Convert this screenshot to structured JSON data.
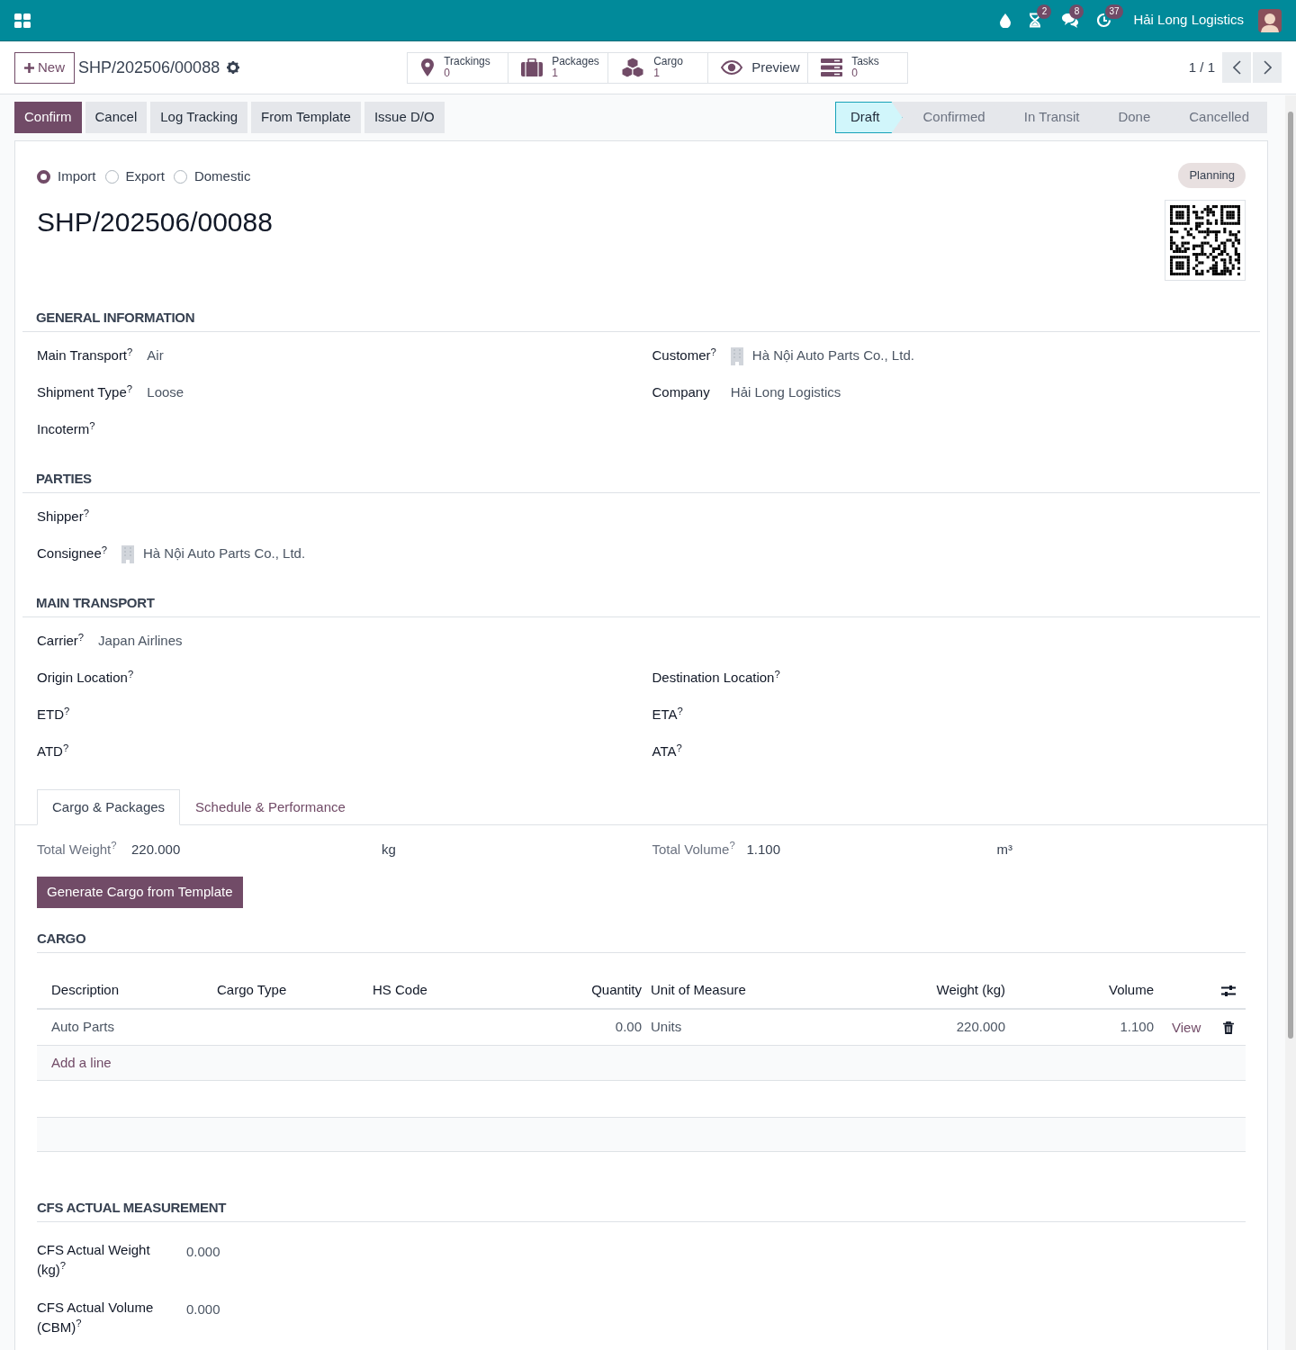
{
  "navbar": {
    "company": "Hải Long Logistics",
    "badges": [
      "2",
      "8",
      "37"
    ]
  },
  "control_panel": {
    "new_button": "New",
    "record_name": "SHP/202506/00088",
    "pager": "1 / 1",
    "smart_buttons": [
      {
        "label": "Trackings",
        "count": "0"
      },
      {
        "label": "Packages",
        "count": "1"
      },
      {
        "label": "Cargo",
        "count": "1"
      },
      {
        "label": "Preview"
      },
      {
        "label": "Tasks",
        "count": "0"
      }
    ]
  },
  "actions": [
    {
      "label": "Confirm",
      "kind": "primary"
    },
    {
      "label": "Cancel",
      "kind": "secondary"
    },
    {
      "label": "Log Tracking",
      "kind": "secondary"
    },
    {
      "label": "From Template",
      "kind": "secondary"
    },
    {
      "label": "Issue D/O",
      "kind": "secondary"
    }
  ],
  "stages": [
    {
      "label": "Draft",
      "selected": true
    },
    {
      "label": "Confirmed",
      "selected": false
    },
    {
      "label": "In Transit",
      "selected": false
    },
    {
      "label": "Done",
      "selected": false
    },
    {
      "label": "Cancelled",
      "selected": false
    }
  ],
  "form": {
    "direction": [
      {
        "label": "Import",
        "selected": true
      },
      {
        "label": "Export",
        "selected": false
      },
      {
        "label": "Domestic",
        "selected": false
      }
    ],
    "tag": "Planning",
    "title": "SHP/202506/00088",
    "sections": [
      {
        "title": "GENERAL INFORMATION",
        "columns": [
          [
            {
              "label": "Main Transport$^{?}$",
              "value": "Air"
            },
            {
              "label": "Shipment Type$^{?}$",
              "value": "Loose"
            },
            {
              "label": "Incoterm$^{?}$"
            }
          ],
          [
            {
              "label": "Customer$^{?}$",
              "value": "Hà Nội Auto Parts Co., Ltd.",
              "kind": "partner"
            },
            {
              "label": "Company",
              "value": "Hải Long Logistics"
            }
          ]
        ]
      },
      {
        "title": "PARTIES",
        "fields": [
          {
            "label": "Shipper$^{?}$"
          },
          {
            "label": "Consignee$^{?}$",
            "value": "Hà Nội Auto Parts Co., Ltd.",
            "kind": "partner"
          }
        ]
      },
      {
        "title": "MAIN TRANSPORT",
        "fields": [
          {
            "label": "Carrier$^{?}$",
            "value": "Japan Airlines"
          }
        ],
        "columns": [
          [
            {
              "label": "Origin Location$^{?}$"
            },
            {
              "label": "ETD$^{?}$"
            },
            {
              "label": "ATD$^{?}$"
            }
          ],
          [
            {
              "label": "Destination Location$^{?}$"
            },
            {
              "label": "ETA$^{?}$"
            },
            {
              "label": "ATA$^{?}$"
            }
          ]
        ]
      }
    ],
    "tabs": [
      {
        "label": "Cargo & Packages",
        "selected": true
      },
      {
        "label": "Schedule & Performance",
        "selected": false
      }
    ],
    "totals": [
      {
        "label": "Total Weight$^{?}$",
        "value": "220.000",
        "unit": "kg"
      },
      {
        "label": "Total Volume$^{?}$",
        "value": "1.100",
        "unit": "m³"
      }
    ],
    "generate_button": "Generate Cargo from Template",
    "cargo": {
      "title": "CARGO",
      "columns": [
        "Description",
        "Cargo Type",
        "HS Code",
        "Quantity",
        "Unit of Measure",
        "Weight (kg)",
        "Volume"
      ],
      "rows": [
        {
          "cells": [
            "Auto Parts",
            null,
            null,
            "0.00",
            "Units",
            "220.000",
            "1.100"
          ],
          "link": "View"
        }
      ],
      "add_line": "Add a line"
    },
    "cfs": {
      "title": "CFS ACTUAL MEASUREMENT",
      "fields": [
        {
          "label": "CFS Actual Weight (kg)$^{?}$",
          "value": "0.000"
        },
        {
          "label": "CFS Actual Volume (CBM)$^{?}$",
          "value": "0.000"
        }
      ]
    }
  }
}
